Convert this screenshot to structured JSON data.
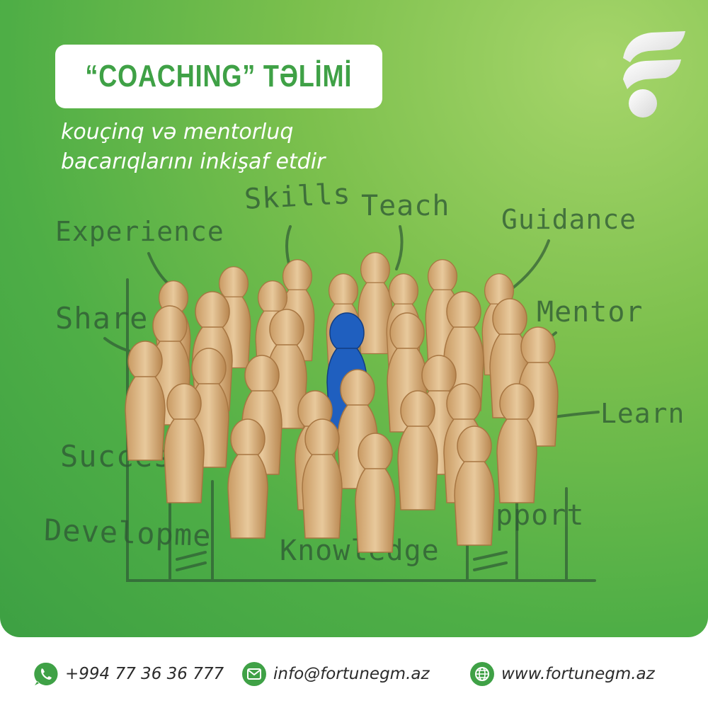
{
  "title": "“COACHING” TƏLİMİ",
  "subtitle": {
    "line1": "kouçinq və mentorluq",
    "line2": "bacarıqlarını inkişaf etdir"
  },
  "chalk_words": {
    "skills": "Skills",
    "teach": "Teach",
    "experience": "Experience",
    "guidance": "Guidance",
    "share": "Share",
    "mentor": "Mentor",
    "learn": "Learn",
    "success": "Succes",
    "support": "pport",
    "development": "Developme",
    "knowledge": "Knowledge"
  },
  "contacts": {
    "phone": "+994 77 36 36 777",
    "email": "info@fortunegm.az",
    "website": "www.fortunegm.az"
  },
  "icons": {
    "phone": "whatsapp-icon",
    "email": "mail-icon",
    "website": "globe-icon",
    "brand": "fortune-logo"
  },
  "colors": {
    "brand_green": "#3fa146",
    "background_light": "#a6d56a",
    "figure_wood": "#dcb788",
    "figure_highlight": "#1f5fbf"
  }
}
